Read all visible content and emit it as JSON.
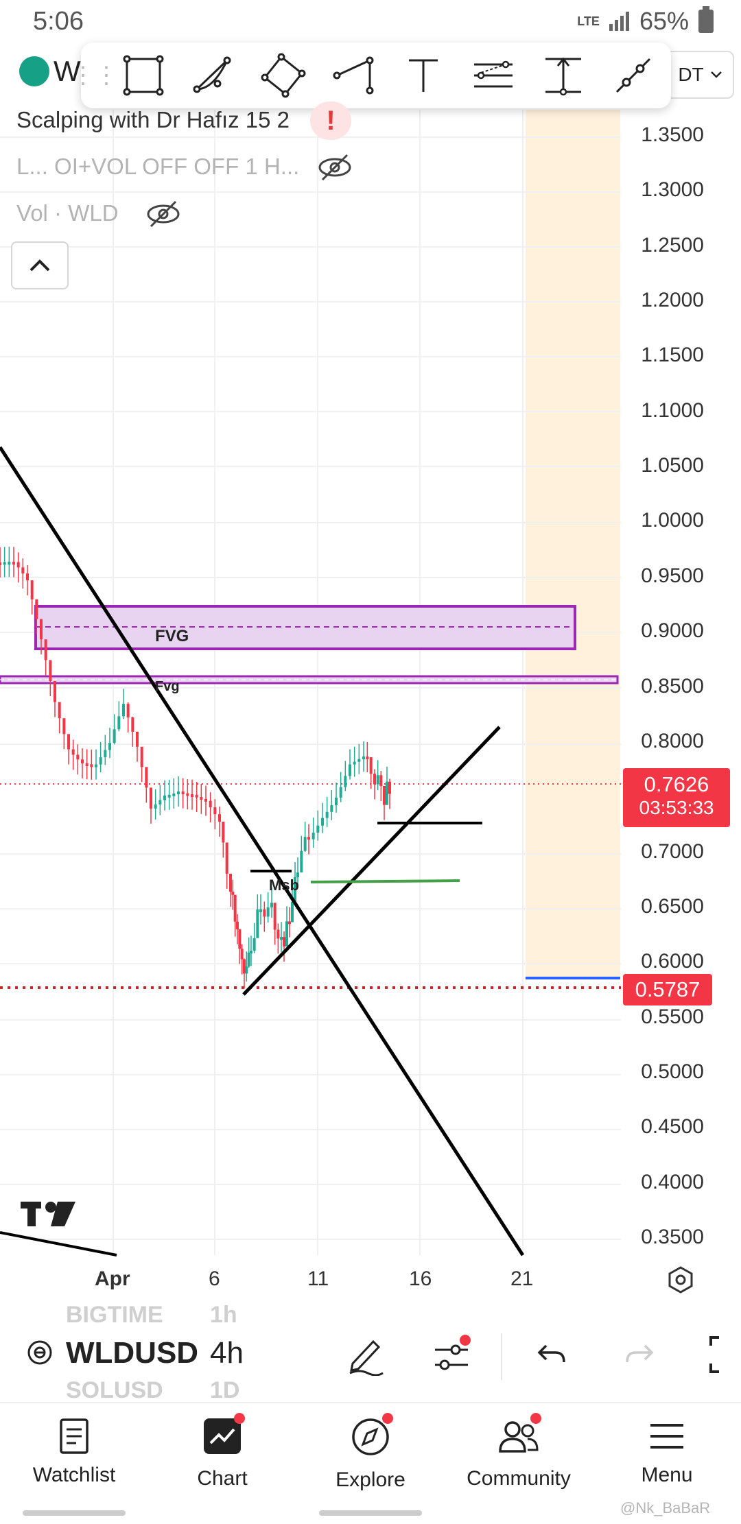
{
  "status_bar": {
    "time": "5:06",
    "network": "LTE",
    "battery": "65%"
  },
  "toolbar": {
    "tools": [
      "rectangle-tool-icon",
      "arc-tool-icon",
      "rotated-rectangle-tool-icon",
      "path-tool-icon",
      "text-tool-icon",
      "parallel-channel-tool-icon",
      "price-range-tool-icon",
      "trend-line-tool-icon"
    ]
  },
  "header": {
    "symbol_partial": "W",
    "quote_partial": "DT"
  },
  "indicators": {
    "strategy": "Scalping with Dr Hafız 15 2",
    "indicator2": "L... OI+VOL OFF OFF 1 H...",
    "volume": "Vol · WLD"
  },
  "price_axis": {
    "ticks": [
      "1.3500",
      "1.3000",
      "1.2500",
      "1.2000",
      "1.1500",
      "1.1000",
      "1.0500",
      "1.0000",
      "0.9500",
      "0.9000",
      "0.8500",
      "0.8000",
      "0.7000",
      "0.6500",
      "0.6000",
      "0.5500",
      "0.5000",
      "0.4500",
      "0.4000",
      "0.3500"
    ],
    "current_price": "0.7626",
    "countdown": "03:53:33",
    "low_marker": "0.5787"
  },
  "date_axis": {
    "ticks": [
      "Apr",
      "6",
      "11",
      "16",
      "21"
    ]
  },
  "chart_annotations": {
    "fvg_upper": "FVG",
    "fvg_lower": "Fvg",
    "msb": "Msb"
  },
  "colors": {
    "bull": "#22ab94",
    "bear": "#f23645",
    "fvg": "#9c27b0",
    "session_band": "#fff1dc",
    "accent": "#f23645"
  },
  "symbol_switcher": {
    "prev_symbol": "BIGTIME",
    "prev_interval": "1h",
    "symbol": "WLDUSD",
    "interval": "4h",
    "next_symbol": "SOLUSD",
    "next_interval": "1D"
  },
  "bottom_nav": [
    {
      "label": "Watchlist"
    },
    {
      "label": "Chart"
    },
    {
      "label": "Explore"
    },
    {
      "label": "Community"
    },
    {
      "label": "Menu"
    }
  ],
  "watermark": "@Nk_BaBaR"
}
